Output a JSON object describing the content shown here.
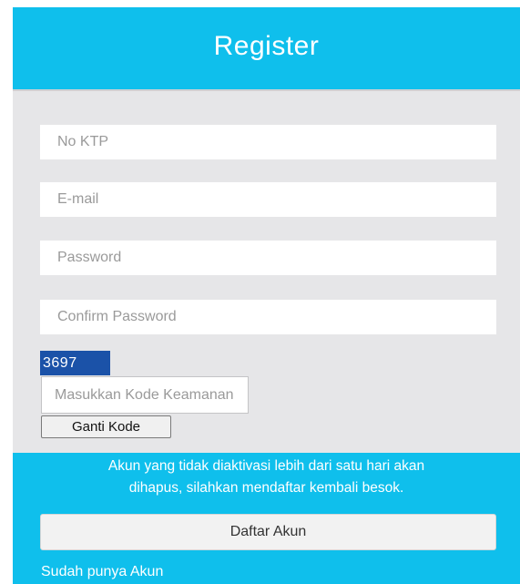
{
  "header": {
    "title": "Register"
  },
  "form": {
    "ktp_placeholder": "No KTP",
    "email_placeholder": "E-mail",
    "password_placeholder": "Password",
    "confirm_password_placeholder": "Confirm Password",
    "captcha_code": "3697",
    "code_placeholder": "Masukkan Kode Keamanan",
    "change_code_label": "Ganti Kode"
  },
  "footer": {
    "notice_line1": "Akun yang tidak diaktivasi lebih dari satu hari akan",
    "notice_line2": "dihapus, silahkan mendaftar kembali besok.",
    "submit_label": "Daftar Akun",
    "login_link": "Sudah punya Akun"
  },
  "colors": {
    "accent": "#0fbfec",
    "panel_background": "#e6e6e8",
    "captcha_background": "#1b52a8"
  }
}
